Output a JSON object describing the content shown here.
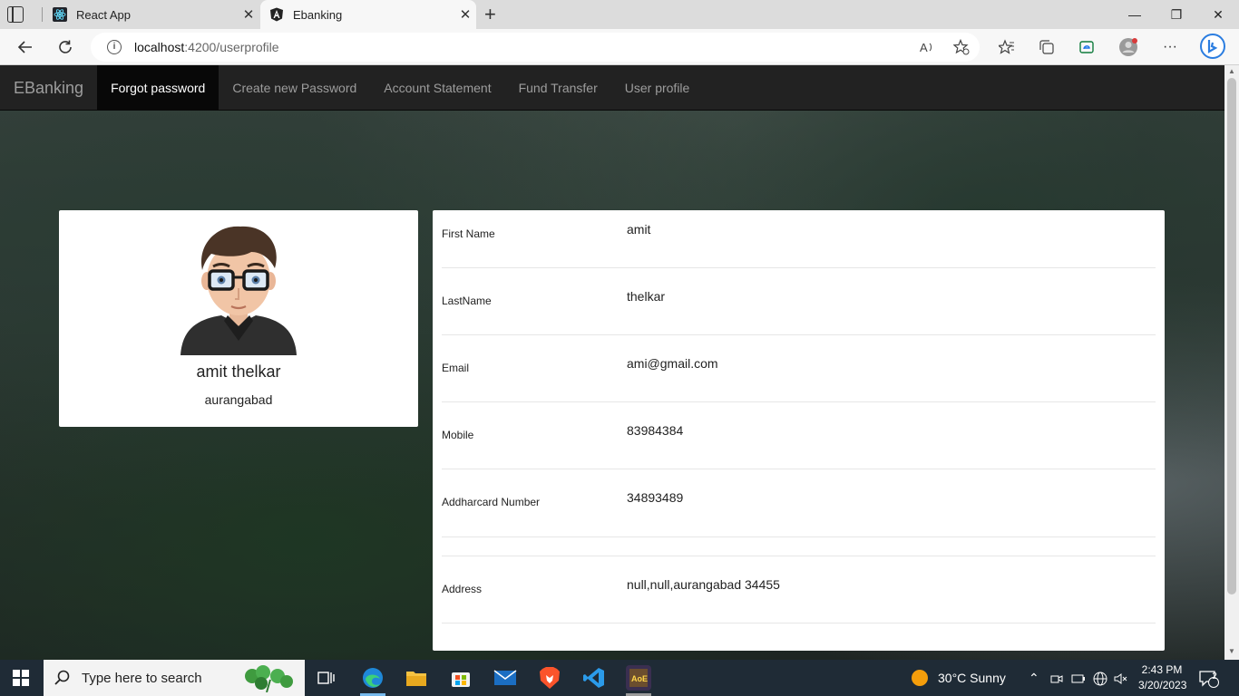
{
  "browser": {
    "tabs": [
      {
        "title": "React App",
        "icon": "react-icon"
      },
      {
        "title": "Ebanking",
        "icon": "angular-icon"
      }
    ],
    "url_host": "localhost",
    "url_path": ":4200/userprofile",
    "window_controls": {
      "minimize": "—",
      "restore": "❐",
      "close": "✕"
    }
  },
  "navbar": {
    "brand": "EBanking",
    "items": [
      "Forgot password",
      "Create new Password",
      "Account Statement",
      "Fund Transfer",
      "User profile"
    ],
    "active_index": 0
  },
  "profile": {
    "name": "amit thelkar",
    "city": "aurangabad"
  },
  "details": [
    {
      "label": "First Name",
      "value": "amit"
    },
    {
      "label": "LastName",
      "value": "thelkar"
    },
    {
      "label": "Email",
      "value": "ami@gmail.com"
    },
    {
      "label": "Mobile",
      "value": "83984384"
    },
    {
      "label": "Addharcard Number",
      "value": "34893489"
    },
    {
      "label": "Address",
      "value": "null,null,aurangabad 34455"
    }
  ],
  "taskbar": {
    "search_placeholder": "Type here to search",
    "weather": "30°C  Sunny",
    "time": "2:43 PM",
    "date": "3/20/2023",
    "notification_count": "2"
  },
  "colors": {
    "navbar_bg": "#222222",
    "navbar_active": "#080808",
    "card_bg": "#ffffff"
  }
}
